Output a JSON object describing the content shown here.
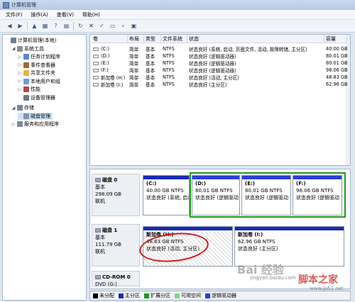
{
  "window": {
    "title": "计算机管理"
  },
  "menu": [
    "文件(F)",
    "操作(A)",
    "查看(V)",
    "帮助(H)"
  ],
  "tree": [
    {
      "label": "计算机管理(本地)",
      "level": 0,
      "exp": "",
      "icon": "computer-icon",
      "color": "#6a7f99"
    },
    {
      "label": "系统工具",
      "level": 1,
      "exp": "◢",
      "icon": "tools-icon",
      "color": "#8a8f99"
    },
    {
      "label": "任务计划程序",
      "level": 2,
      "exp": "▷",
      "icon": "clock-icon",
      "color": "#5b86c2"
    },
    {
      "label": "事件查看器",
      "level": 2,
      "exp": "▷",
      "icon": "event-icon",
      "color": "#a06a2c"
    },
    {
      "label": "共享文件夹",
      "level": 2,
      "exp": "▷",
      "icon": "folder-icon",
      "color": "#e3b444"
    },
    {
      "label": "本地用户和组",
      "level": 2,
      "exp": "▷",
      "icon": "users-icon",
      "color": "#6f9bd2"
    },
    {
      "label": "性能",
      "level": 2,
      "exp": "▷",
      "icon": "performance-icon",
      "color": "#b04a4a"
    },
    {
      "label": "设备管理器",
      "level": 2,
      "exp": "",
      "icon": "device-icon",
      "color": "#6b7a8c"
    },
    {
      "label": "存储",
      "level": 1,
      "exp": "◢",
      "icon": "storage-icon",
      "color": "#7a8696"
    },
    {
      "label": "磁盘管理",
      "level": 2,
      "exp": "",
      "icon": "disk-icon",
      "color": "#8494a8",
      "selected": true
    },
    {
      "label": "服务和应用程序",
      "level": 1,
      "exp": "▷",
      "icon": "services-icon",
      "color": "#7e8aa0"
    }
  ],
  "columns": [
    "卷",
    "布局",
    "类型",
    "文件系统",
    "状态",
    "容量"
  ],
  "volumes": [
    {
      "vol": "(C:)",
      "layout": "简单",
      "type": "基本",
      "fs": "NTFS",
      "status": "状态良好 (系统, 启动, 页面文件, 活动, 故障转储, 主分区)",
      "cap": "40.00 GB"
    },
    {
      "vol": "(D:)",
      "layout": "简单",
      "type": "基本",
      "fs": "NTFS",
      "status": "状态良好 (逻辑驱动器)",
      "cap": "80.01 GB"
    },
    {
      "vol": "(E:)",
      "layout": "简单",
      "type": "基本",
      "fs": "NTFS",
      "status": "状态良好 (逻辑驱动器)",
      "cap": "80.01 GB"
    },
    {
      "vol": "(F:)",
      "layout": "简单",
      "type": "基本",
      "fs": "NTFS",
      "status": "状态良好 (逻辑驱动器)",
      "cap": "98.06 GB"
    },
    {
      "vol": "新加卷 (H:)",
      "layout": "简单",
      "type": "基本",
      "fs": "NTFS",
      "status": "状态良好 (活动, 主分区)",
      "cap": "48.83 GB"
    },
    {
      "vol": "新加卷 (I:)",
      "layout": "简单",
      "type": "基本",
      "fs": "NTFS",
      "status": "状态良好 (主分区)",
      "cap": "62.96 GB"
    }
  ],
  "disks": [
    {
      "name": "磁盘 0",
      "type": "基本",
      "size": "298.09 GB",
      "state": "联机",
      "parts": [
        {
          "name": "(C:)",
          "size": "40.00 GB NTFS",
          "status": "状态良好 (系统, 启动"
        },
        {
          "name": "(D:)",
          "size": "80.01 GB NTFS",
          "status": "状态良好 (逻辑驱动"
        },
        {
          "name": "(E:)",
          "size": "80.01 GB NTFS",
          "status": "状态良好 (逻辑驱动"
        },
        {
          "name": "(F:)",
          "size": "98.06 GB NTFS",
          "status": "状态良好 (逻辑驱动"
        }
      ]
    },
    {
      "name": "磁盘 1",
      "type": "基本",
      "size": "111.79 GB",
      "state": "联机",
      "parts": [
        {
          "name": "新加卷 (H:)",
          "size": "48.83 GB NTFS",
          "status": "状态良好 (活动, 主分区)"
        },
        {
          "name": "新加卷 (I:)",
          "size": "62.96 GB NTFS",
          "status": "状态良好 (主分区)"
        }
      ]
    },
    {
      "name": "CD-ROM 0",
      "type": "DVD (G:)",
      "size": "",
      "state": ""
    }
  ],
  "legend": [
    {
      "label": "未分配",
      "color": "#000000"
    },
    {
      "label": "主分区",
      "color": "#1a2bb0"
    },
    {
      "label": "扩展分区",
      "color": "#1e9b1e"
    },
    {
      "label": "可用空间",
      "color": "#7fd67f"
    },
    {
      "label": "逻辑驱动器",
      "color": "#2c3fd4"
    }
  ],
  "watermarks": {
    "baidu": "Bai 经验",
    "baidu_url": "jingyan.baidu.com",
    "site": "脚本之家",
    "site_url": "www.jb51.net"
  }
}
